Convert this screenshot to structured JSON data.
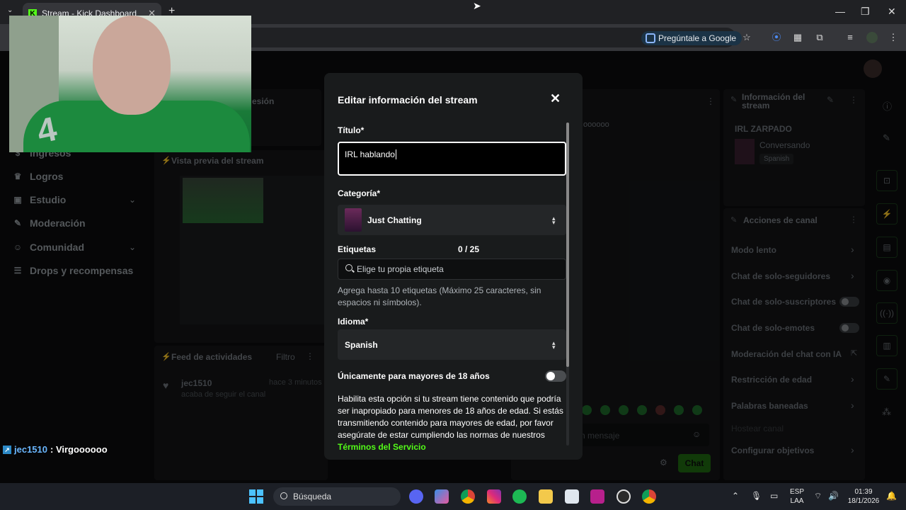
{
  "browser": {
    "tab_title": "Stream - Kick Dashboard",
    "ask_google": "Pregúntale a Google",
    "new_tab": "+",
    "tab_close": "✕"
  },
  "sidebar": {
    "items": [
      {
        "label": "Ingresos",
        "icon": "money-icon"
      },
      {
        "label": "Logros",
        "icon": "trophy-icon"
      },
      {
        "label": "Estudio",
        "icon": "studio-icon"
      },
      {
        "label": "Moderación",
        "icon": "wrench-icon"
      },
      {
        "label": "Comunidad",
        "icon": "people-icon"
      },
      {
        "label": "Drops y recompensas",
        "icon": "drops-icon"
      }
    ]
  },
  "panels": {
    "session_title_partial": "esión",
    "preview_title": "Vista previa del stream",
    "activity_title": "Feed de actividades",
    "activity_filter": "Filtro",
    "activity_item": {
      "user": "jec1510",
      "time": "hace 3 minutos",
      "text": "acaba de seguir el canal"
    },
    "chat_partial_text": "oooooo",
    "chat_placeholder": "n mensaje",
    "chat_button": "Chat"
  },
  "stream_info": {
    "title": "Información del stream",
    "stream_name": "IRL ZARPADO",
    "category": "Conversando",
    "language": "Spanish"
  },
  "channel_actions": {
    "title": "Acciones de canal",
    "items": [
      {
        "label": "Modo lento",
        "control": "chevron"
      },
      {
        "label": "Chat de solo-seguidores",
        "control": "chevron"
      },
      {
        "label": "Chat de solo-suscriptores",
        "control": "toggle"
      },
      {
        "label": "Chat de solo-emotes",
        "control": "toggle"
      },
      {
        "label": "Moderación del chat con IA",
        "control": "external"
      },
      {
        "label": "Restricción de edad",
        "control": "chevron"
      },
      {
        "label": "Palabras baneadas",
        "control": "chevron"
      },
      {
        "label": "Hostear canal",
        "control": "none"
      },
      {
        "label": "Configurar objetivos",
        "control": "chevron"
      }
    ]
  },
  "modal": {
    "title": "Editar información del stream",
    "title_label": "Título*",
    "title_value": "IRL hablando",
    "category_label": "Categoría*",
    "category_value": "Just Chatting",
    "tags_label": "Etiquetas",
    "tags_count": "0 / 25",
    "tags_placeholder": "Elige tu propia etiqueta",
    "tags_help": "Agrega hasta 10 etiquetas (Máximo 25 caracteres, sin espacios ni símbolos).",
    "language_label": "Idioma*",
    "language_value": "Spanish",
    "adult_label": "Únicamente para mayores de 18 años",
    "adult_enabled": false,
    "adult_desc": "Habilita esta opción si tu stream tiene contenido que podría ser inapropiado para menores de 18 años de edad. Si estás transmitiendo contenido para mayores de edad, por favor asegúrate de estar cumpliendo las normas de nuestros",
    "adult_link": "Términos del Servicio"
  },
  "chat_overlay": {
    "user": "jec1510",
    "message": ": Virgoooooo"
  },
  "taskbar": {
    "search": "Búsqueda",
    "lang_top": "ESP",
    "lang_bottom": "LAA",
    "time": "01:39",
    "date": "18/1/2026"
  },
  "colors": {
    "accent": "#53fc18",
    "modal_bg": "#191b1c"
  }
}
